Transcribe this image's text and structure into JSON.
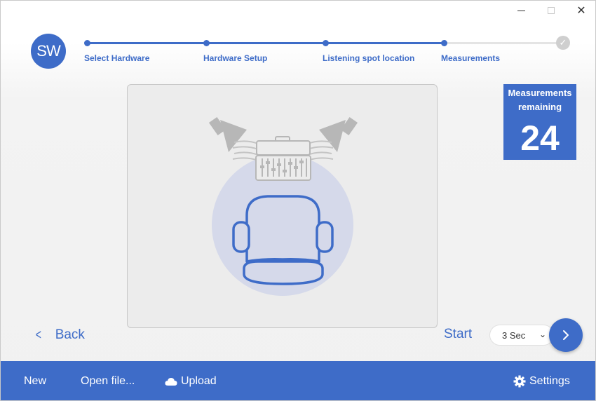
{
  "window": {
    "controls": {
      "minimize": "",
      "maximize": "",
      "close": "✕"
    }
  },
  "logo": {
    "text": "SW"
  },
  "stepper": {
    "steps": [
      {
        "label": "Select Hardware"
      },
      {
        "label": "Hardware Setup"
      },
      {
        "label": "Listening spot location"
      },
      {
        "label": "Measurements"
      }
    ],
    "final_icon": "check-icon"
  },
  "remaining": {
    "label": "Measurements remaining",
    "count": "24"
  },
  "nav": {
    "back_label": "Back",
    "start_label": "Start",
    "delay_value": "3 Sec",
    "next_icon": "chevron-right-icon"
  },
  "footer": {
    "new_label": "New",
    "open_label": "Open file...",
    "upload_label": "Upload",
    "settings_label": "Settings"
  },
  "colors": {
    "accent": "#3e6cc8",
    "panel_bg": "#ececec",
    "listening_zone": "#d5d9ea",
    "hardware_gray": "#b7b7b7"
  }
}
